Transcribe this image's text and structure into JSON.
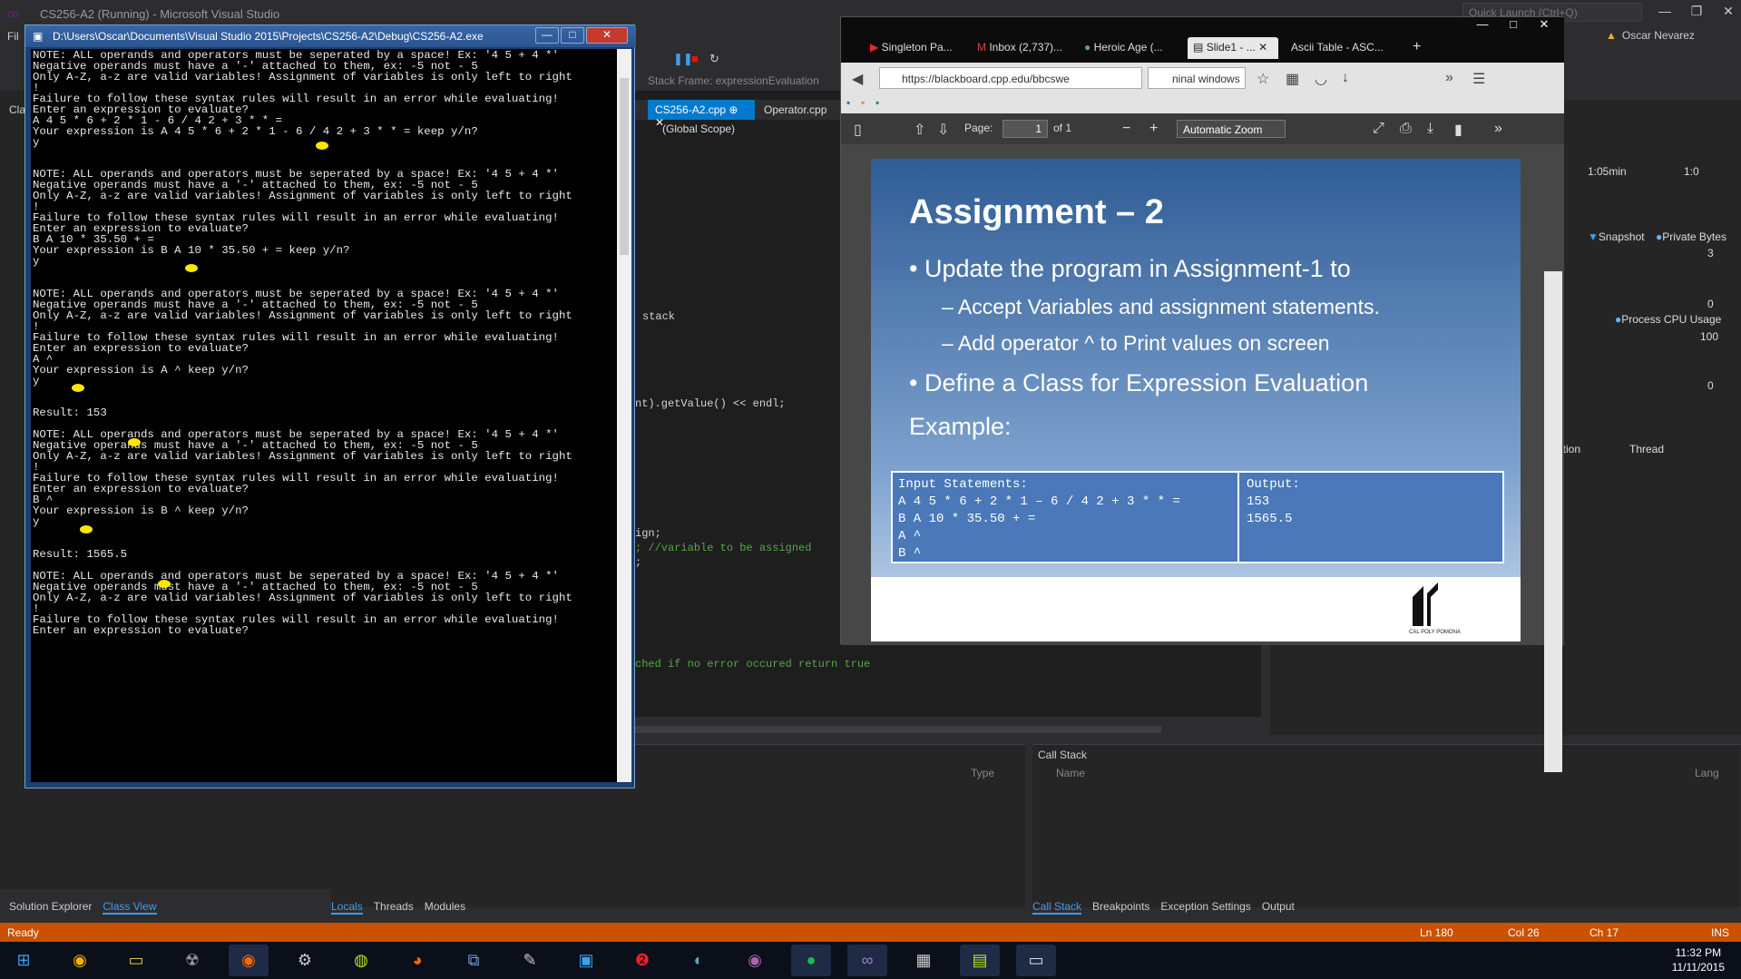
{
  "vs": {
    "title": "CS256-A2 (Running) - Microsoft Visual Studio",
    "quick_launch_placeholder": "Quick Launch (Ctrl+Q)",
    "user": "Oscar Nevarez",
    "menu_first": "Fil",
    "stack_frame_label": "Stack Frame:",
    "stack_frame_value": "expressionEvaluation",
    "tabs": [
      "CS256-A2.cpp",
      "Operator.cpp"
    ],
    "scope": "(Global Scope)",
    "code_lines": [
      "stack",
      "nt).getValue() << endl;",
      "ign;",
      "; //variable to be assigned",
      ";",
      "ched if no error occured return true"
    ],
    "diag": {
      "time_1": "1:05min",
      "time_2": "1:0",
      "snapshot": "Snapshot",
      "private_bytes": "Private Bytes",
      "mem_max": "3",
      "mem_min": "0",
      "cpu_label": "Process CPU Usage",
      "cpu_max": "100",
      "cpu_min": "0",
      "col_ation": "ation",
      "col_thread": "Thread"
    },
    "locals": {
      "type_header": "Type"
    },
    "callstack": {
      "title": "Call Stack",
      "name_header": "Name",
      "lang_header": "Lang"
    },
    "bottom_tabs_left": [
      "Locals",
      "Threads",
      "Modules"
    ],
    "bottom_tabs_right": [
      "Call Stack",
      "Breakpoints",
      "Exception Settings",
      "Output"
    ],
    "solution_tabs": [
      "Solution Explorer",
      "Class View"
    ],
    "left_labels": [
      "Cla"
    ],
    "status": {
      "ready": "Ready",
      "ln": "Ln 180",
      "col": "Col 26",
      "ch": "Ch 17",
      "ins": "INS"
    }
  },
  "console": {
    "title": "D:\\Users\\Oscar\\Documents\\Visual Studio 2015\\Projects\\CS256-A2\\Debug\\CS256-A2.exe",
    "lines": [
      "NOTE: ALL operands and operators must be seperated by a space! Ex: '4 5 + 4 *'",
      "Negative operands must have a '-' attached to them, ex: -5 not - 5",
      "Only A-Z, a-z are valid variables! Assignment of variables is only left to right",
      "!",
      "Failure to follow these syntax rules will result in an error while evaluating!",
      "Enter an expression to evaluate?",
      "A 4 5 * 6 + 2 * 1 - 6 / 4 2 + 3 * * =",
      "Your expression is A 4 5 * 6 + 2 * 1 - 6 / 4 2 + 3 * * = keep y/n?",
      "y",
      "",
      "",
      "NOTE: ALL operands and operators must be seperated by a space! Ex: '4 5 + 4 *'",
      "Negative operands must have a '-' attached to them, ex: -5 not - 5",
      "Only A-Z, a-z are valid variables! Assignment of variables is only left to right",
      "!",
      "Failure to follow these syntax rules will result in an error while evaluating!",
      "Enter an expression to evaluate?",
      "B A 10 * 35.50 + =",
      "Your expression is B A 10 * 35.50 + = keep y/n?",
      "y",
      "",
      "",
      "NOTE: ALL operands and operators must be seperated by a space! Ex: '4 5 + 4 *'",
      "Negative operands must have a '-' attached to them, ex: -5 not - 5",
      "Only A-Z, a-z are valid variables! Assignment of variables is only left to right",
      "!",
      "Failure to follow these syntax rules will result in an error while evaluating!",
      "Enter an expression to evaluate?",
      "A ^",
      "Your expression is A ^ keep y/n?",
      "y",
      "",
      "",
      "Result: 153",
      "",
      "NOTE: ALL operands and operators must be seperated by a space! Ex: '4 5 + 4 *'",
      "Negative operands must have a '-' attached to them, ex: -5 not - 5",
      "Only A-Z, a-z are valid variables! Assignment of variables is only left to right",
      "!",
      "Failure to follow these syntax rules will result in an error while evaluating!",
      "Enter an expression to evaluate?",
      "B ^",
      "Your expression is B ^ keep y/n?",
      "y",
      "",
      "",
      "Result: 1565.5",
      "",
      "NOTE: ALL operands and operators must be seperated by a space! Ex: '4 5 + 4 *'",
      "Negative operands must have a '-' attached to them, ex: -5 not - 5",
      "Only A-Z, a-z are valid variables! Assignment of variables is only left to right",
      "!",
      "Failure to follow these syntax rules will result in an error while evaluating!",
      "Enter an expression to evaluate?"
    ]
  },
  "firefox": {
    "tabs": [
      "Singleton Pa...",
      "Inbox (2,737)...",
      "Heroic Age (...",
      "Slide1 - ...",
      "Ascii Table - ASC..."
    ],
    "active_tab_index": 3,
    "url": "https://blackboard.cpp.edu/bbcswe",
    "search": "ninal windows",
    "pdf": {
      "page_label": "Page:",
      "page": "1",
      "of": "of 1",
      "zoom": "Automatic Zoom"
    },
    "slide": {
      "title": "Assignment – 2",
      "bullet1": "Update the program in Assignment-1 to",
      "sub1": "– Accept Variables and assignment statements.",
      "sub2": "– Add operator ^ to Print values on screen",
      "bullet2": "Define a Class for Expression Evaluation",
      "example": "Example:",
      "table_input": "Input Statements:\nA 4 5 * 6 + 2 * 1 – 6 / 4 2 + 3 * * =\nB A 10 * 35.50 + =\nA ^\nB ^",
      "table_output": "Output:\n153\n1565.5",
      "logo_text": "CAL POLY POMONA"
    }
  },
  "clock": {
    "time": "11:32 PM",
    "date": "11/11/2015"
  },
  "colors": {
    "vs_accent": "#007acc",
    "statusbar": "#ca5100",
    "highlight": "#ffe600"
  }
}
